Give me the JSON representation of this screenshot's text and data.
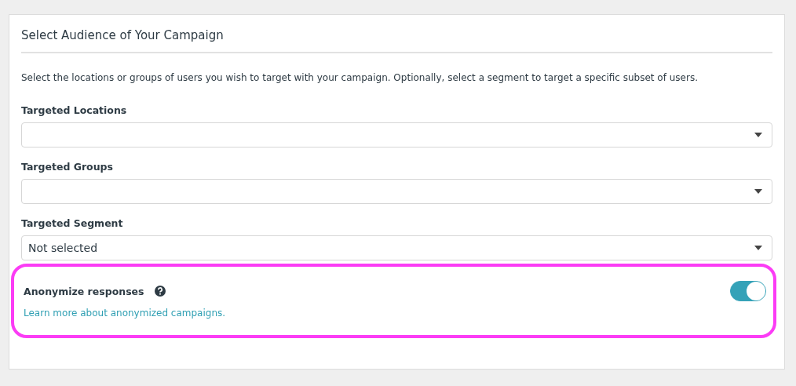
{
  "card": {
    "title": "Select Audience of Your Campaign",
    "description": "Select the locations or groups of users you wish to target with your campaign. Optionally, select a segment to target a specific subset of users.",
    "fields": [
      {
        "label": "Targeted Locations"
      },
      {
        "label": "Targeted Groups"
      },
      {
        "label": "Targeted Segment",
        "value": "Not selected"
      }
    ],
    "anonymize": {
      "label": "Anonymize responses",
      "link": "Learn more about anonymized campaigns.",
      "on": true,
      "highlighted": true
    }
  }
}
